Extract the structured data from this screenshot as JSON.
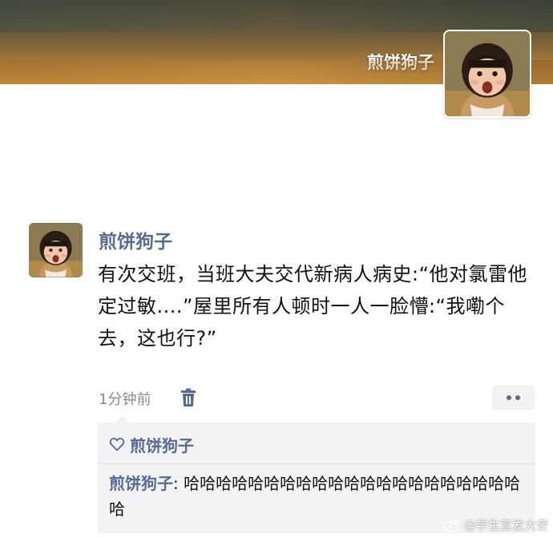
{
  "cover": {
    "name": "煎饼狗子"
  },
  "post": {
    "author": "煎饼狗子",
    "text": "有次交班，当班大夫交代新病人病史:“他对氯雷他定过敏....”屋里所有人顿时一人一脸懵:“我嘞个去，这也行?”",
    "time": "1分钟前"
  },
  "interactions": {
    "likes": [
      "煎饼狗子"
    ],
    "comments": [
      {
        "author": "煎饼狗子",
        "separator": ": ",
        "text": "哈哈哈哈哈哈哈哈哈哈哈哈哈哈哈哈哈哈哈哈哈哈"
      }
    ]
  },
  "watermark": "@学生宣发大使",
  "colors": {
    "link": "#576b95",
    "text": "#111111",
    "muted": "#8a8a8a",
    "panel": "#f3f3f5"
  },
  "icons": {
    "delete": "trash-icon",
    "more": "more-dots-icon",
    "like": "heart-outline-icon",
    "watermark": "weibo-icon"
  }
}
